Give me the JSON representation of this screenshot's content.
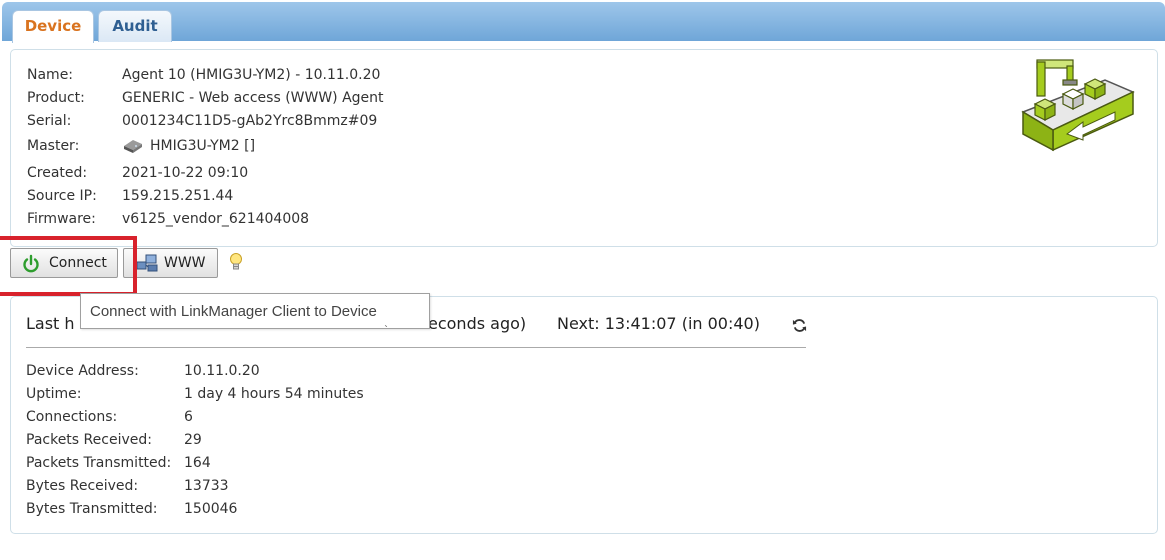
{
  "tabs": [
    {
      "label": "Device",
      "active": true
    },
    {
      "label": "Audit",
      "active": false
    }
  ],
  "device": {
    "name": {
      "label": "Name:",
      "value": "Agent 10 (HMIG3U-YM2) - 10.11.0.20"
    },
    "product": {
      "label": "Product:",
      "value": "GENERIC - Web access (WWW) Agent"
    },
    "serial": {
      "label": "Serial:",
      "value": "0001234C11D5-gAb2Yrc8Bmmz#09"
    },
    "master": {
      "label": "Master:",
      "value": "HMIG3U-YM2 []",
      "icon": "gateway-device-icon"
    },
    "created": {
      "label": "Created:",
      "value": "2021-10-22 09:10"
    },
    "source_ip": {
      "label": "Source IP:",
      "value": "159.215.251.44"
    },
    "firmware": {
      "label": "Firmware:",
      "value": "v6125_vendor_621404008"
    }
  },
  "buttons": {
    "connect": {
      "label": "Connect",
      "icon": "power-icon"
    },
    "www": {
      "label": "WWW",
      "icon": "network-icon"
    },
    "hint_icon": "lightbulb-icon"
  },
  "tooltip": {
    "text": "Connect with LinkManager Client to Device"
  },
  "status": {
    "last_heard_prefix": "Last h",
    "last_heard_suffix": "econds ago)",
    "next": "Next: 13:41:07 (in 00:40)",
    "refresh_icon": "refresh-icon",
    "rows": [
      {
        "label": "Device Address:",
        "value": "10.11.0.20"
      },
      {
        "label": "Uptime:",
        "value": "1 day 4 hours 54 minutes"
      },
      {
        "label": "Connections:",
        "value": "6"
      },
      {
        "label": "Packets Received:",
        "value": "29"
      },
      {
        "label": "Packets Transmitted:",
        "value": "164"
      },
      {
        "label": "Bytes Received:",
        "value": "13733"
      },
      {
        "label": "Bytes Transmitted:",
        "value": "150046"
      }
    ]
  },
  "colors": {
    "accent_tab": "#d9731f",
    "highlight": "#d8222c",
    "device_green": "#a5cc1e"
  }
}
